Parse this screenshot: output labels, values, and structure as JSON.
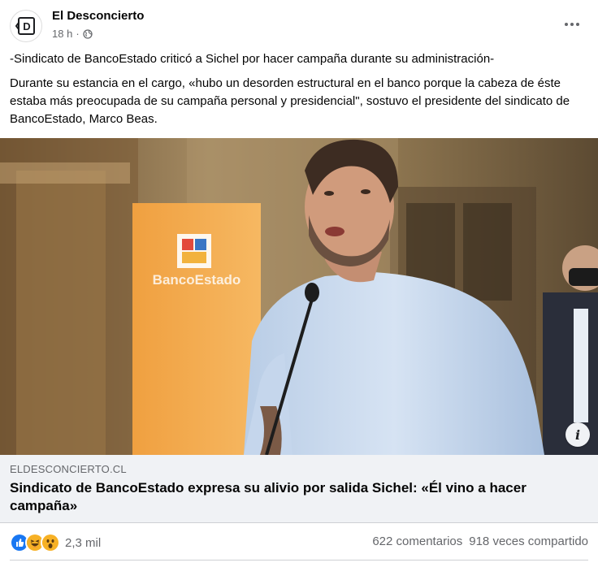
{
  "page": {
    "name": "El Desconcierto",
    "time": "18 h",
    "separator": "·",
    "privacy_icon": "globe-icon",
    "avatar_icon": "el-desconcierto-logo",
    "avatar_letter": "D"
  },
  "post": {
    "headline": "-Sindicato de BancoEstado criticó a Sichel por hacer campaña durante su administración-",
    "body": "Durante su estancia en el cargo, «hubo un desorden estructural en el banco porque la cabeza de éste estaba más preocupada de su campaña personal y presidencial\", sostuvo el presidente del sindicato de BancoEstado, Marco Beas."
  },
  "photo": {
    "banner_text": "BancoEstado",
    "banner_color": "#f5a43a"
  },
  "link": {
    "domain": "ELDESCONCIERTO.CL",
    "title": "Sindicato de BancoEstado expresa su alivio por salida Sichel: «Él vino a hacer campaña»"
  },
  "reactions": {
    "icons": [
      "like-icon",
      "haha-icon",
      "wow-icon"
    ],
    "count": "2,3 mil",
    "comments": "622 comentarios",
    "shares": "918 veces compartido"
  },
  "colors": {
    "text_primary": "#050505",
    "text_secondary": "#65676b",
    "link_bg": "#f0f2f5",
    "like_blue": "#1877f2",
    "emoji_yellow": "#f7b125"
  }
}
